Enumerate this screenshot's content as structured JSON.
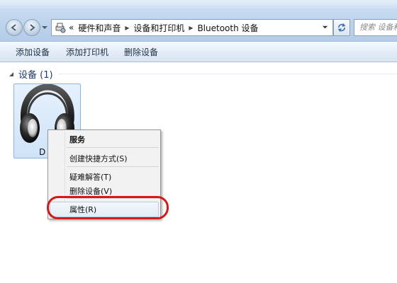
{
  "address": {
    "chevrons": "«",
    "crumbs": [
      "硬件和声音",
      "设备和打印机",
      "Bluetooth 设备"
    ],
    "search_placeholder": "搜索 设备和"
  },
  "toolbar": {
    "add_device": "添加设备",
    "add_printer": "添加打印机",
    "remove_device": "删除设备"
  },
  "group": {
    "title": "设备 (1)"
  },
  "device": {
    "label": "D",
    "icon": "headphones-icon"
  },
  "context_menu": {
    "items": [
      "服务",
      "创建快捷方式(S)",
      "疑难解答(T)",
      "删除设备(V)",
      "属性(R)"
    ]
  },
  "colors": {
    "callout": "#d21a1a",
    "tile_selected": "#cfe3f8"
  }
}
